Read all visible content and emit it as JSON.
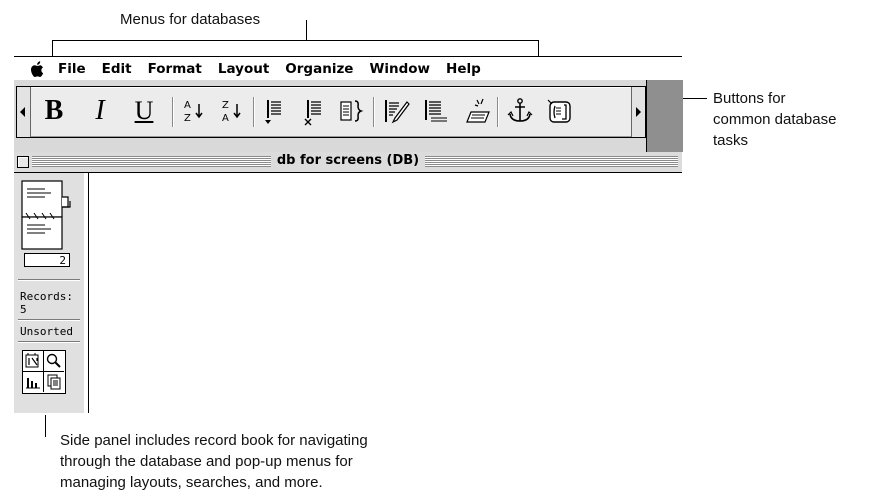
{
  "callouts": {
    "menus": "Menus for databases",
    "buttons": [
      "Buttons for",
      "common database",
      "tasks"
    ],
    "side_panel": [
      "Side panel includes record book for navigating",
      "through the database and pop-up menus for",
      "managing layouts, searches, and more."
    ]
  },
  "menubar": {
    "items": [
      "File",
      "Edit",
      "Format",
      "Layout",
      "Organize",
      "Window",
      "Help"
    ]
  },
  "toolbar": {
    "buttons": [
      {
        "name": "bold-button",
        "label": "B"
      },
      {
        "name": "italic-button",
        "label": "I"
      },
      {
        "name": "underline-button",
        "label": "U"
      },
      {
        "name": "sort-ascending-button",
        "label": ""
      },
      {
        "name": "sort-descending-button",
        "label": ""
      },
      {
        "name": "insert-record-button",
        "label": ""
      },
      {
        "name": "delete-record-button",
        "label": ""
      },
      {
        "name": "record-brackets-button",
        "label": ""
      },
      {
        "name": "edit-layout-button",
        "label": ""
      },
      {
        "name": "list-view-button",
        "label": ""
      },
      {
        "name": "keyboard-entry-button",
        "label": ""
      },
      {
        "name": "anchor-button",
        "label": ""
      },
      {
        "name": "open-document-button",
        "label": ""
      }
    ]
  },
  "window": {
    "title": "db for screens (DB)"
  },
  "sidepanel": {
    "book_page": "2",
    "records_label": "Records:",
    "records_count": "5",
    "sort_status": "Unsorted",
    "tools": [
      "layout-icon",
      "search-icon",
      "report-icon",
      "document-icon"
    ]
  }
}
